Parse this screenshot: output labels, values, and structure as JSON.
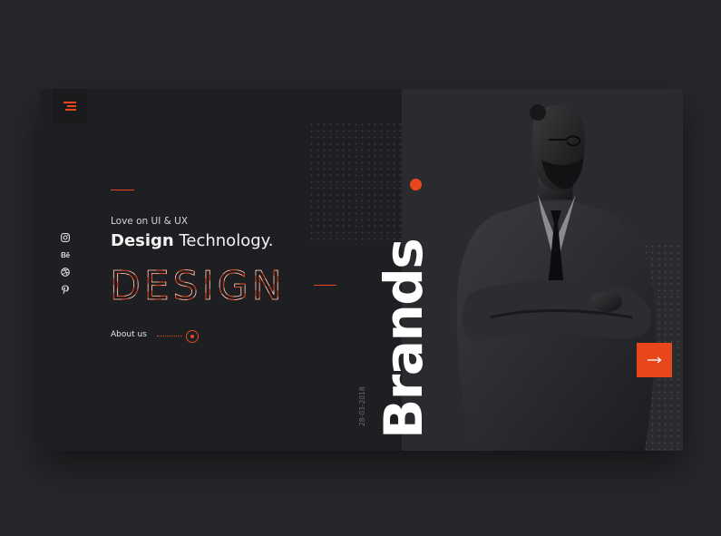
{
  "menu": {
    "icon": "hamburger-menu-icon"
  },
  "social": [
    {
      "icon": "instagram-icon"
    },
    {
      "icon": "behance-icon",
      "label": "Bē"
    },
    {
      "icon": "dribbble-icon"
    },
    {
      "icon": "pinterest-icon"
    }
  ],
  "hero": {
    "tagline": "Love on UI & UX",
    "headline_bold": "Design",
    "headline_rest": " Technology.",
    "design_word": "DESIGN",
    "about_label": "About us",
    "brand_word": "Brands",
    "date": "28-03-2018"
  },
  "next_button": {
    "icon": "arrow-right-icon"
  },
  "colors": {
    "background": "#26272a",
    "card": "#1e1f22",
    "accent": "#e8471b",
    "text": "#ffffff"
  }
}
